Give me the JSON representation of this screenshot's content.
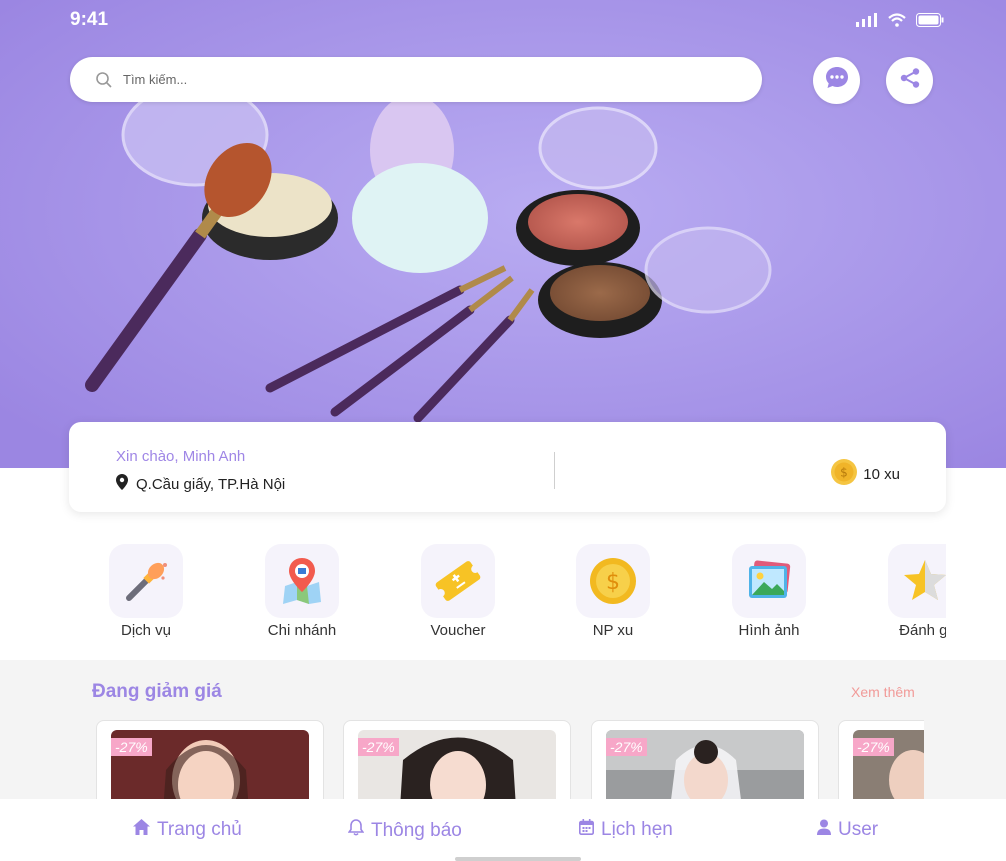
{
  "status": {
    "time": "9:41"
  },
  "search": {
    "placeholder": "Tìm kiếm..."
  },
  "greeting": {
    "hello": "Xin chào, Minh Anh",
    "location": "Q.Cầu giấy, TP.Hà Nội",
    "coins": "10 xu"
  },
  "categories": [
    {
      "label": "Dịch vụ",
      "icon": "makeup-brush-icon"
    },
    {
      "label": "Chi nhánh",
      "icon": "map-pin-store-icon"
    },
    {
      "label": "Voucher",
      "icon": "ticket-icon"
    },
    {
      "label": "NP xu",
      "icon": "coin-icon"
    },
    {
      "label": "Hình ảnh",
      "icon": "gallery-icon"
    },
    {
      "label": "Đánh gi",
      "icon": "star-icon"
    }
  ],
  "sale": {
    "title": "Đang giảm giá",
    "more": "Xem thêm",
    "items": [
      {
        "discount": "-27%"
      },
      {
        "discount": "-27%"
      },
      {
        "discount": "-27%"
      },
      {
        "discount": "-27%"
      }
    ]
  },
  "nav": {
    "home": "Trang chủ",
    "notifications": "Thông báo",
    "schedule": "Lịch hẹn",
    "user": "User"
  },
  "colors": {
    "accent": "#9c86e4",
    "more_link": "#f19a98",
    "badge": "#f7a7c8"
  }
}
